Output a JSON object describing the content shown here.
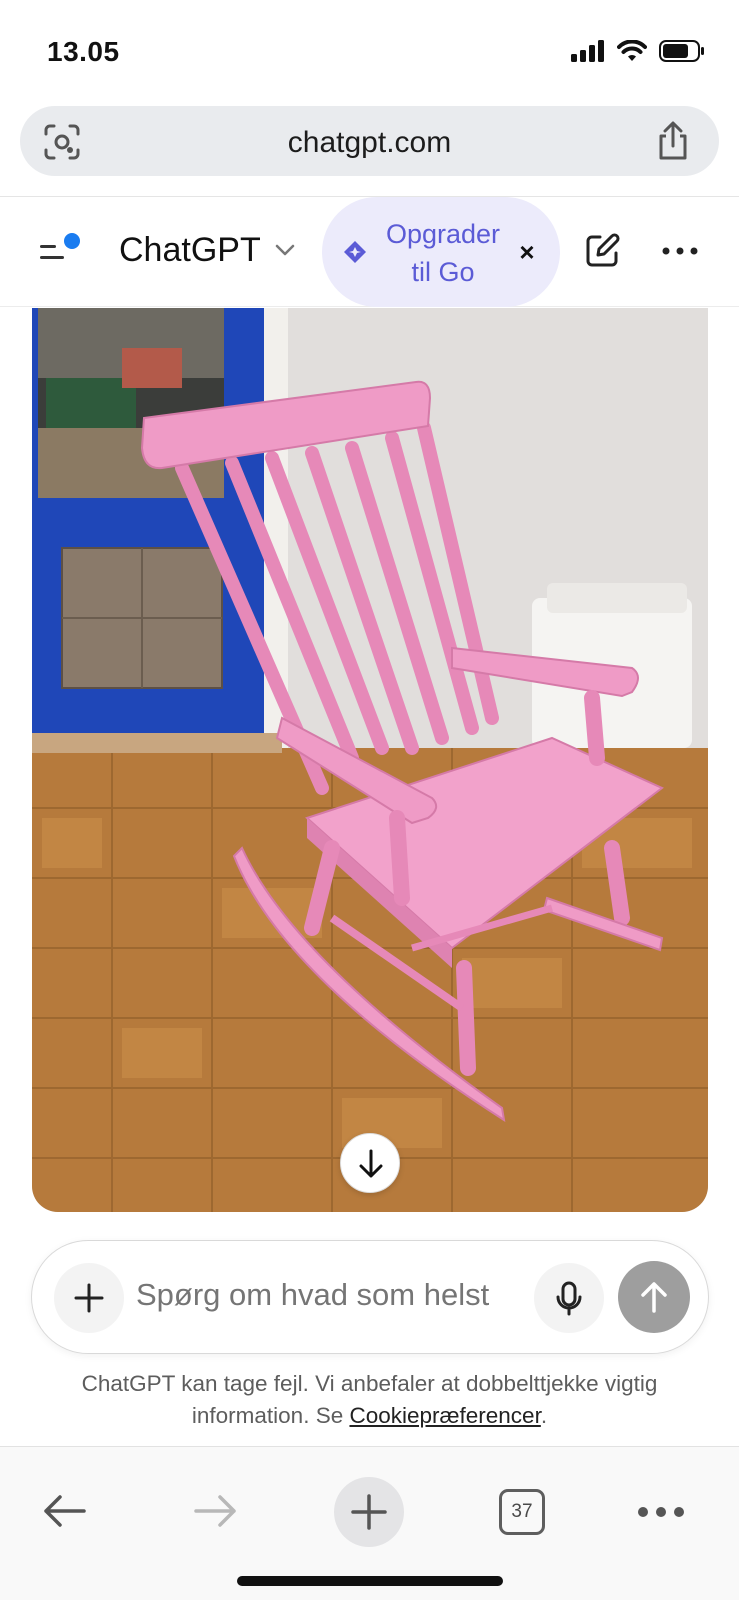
{
  "status_bar": {
    "time": "13.05"
  },
  "browser": {
    "url": "chatgpt.com",
    "tab_count": "37"
  },
  "app_header": {
    "title": "ChatGPT",
    "upgrade_label": "Opgrader til Go",
    "upgrade_close": "×"
  },
  "image": {
    "subject": "pink rocking chair on parquet floor"
  },
  "composer": {
    "placeholder": "Spørg om hvad som helst"
  },
  "disclaimer": {
    "text_before": "ChatGPT kan tage fejl. Vi anbefaler at dobbelttjekke vigtig information. Se ",
    "link": "Cookiepræferencer",
    "text_after": "."
  },
  "colors": {
    "accent": "#5b5bd6",
    "upgrade_bg": "#ecebfb",
    "send_disabled": "#9e9e9e",
    "sidebar_dot": "#1a7cf0"
  },
  "icons": [
    "signal-icon",
    "wifi-icon",
    "battery-icon",
    "lens-icon",
    "share-icon",
    "sidebar-icon",
    "chevron-down-icon",
    "sparkle-icon",
    "close-icon",
    "edit-icon",
    "more-icon",
    "arrow-down-icon",
    "plus-icon",
    "mic-icon",
    "arrow-up-icon",
    "back-arrow-icon",
    "forward-arrow-icon",
    "tabs-icon"
  ]
}
